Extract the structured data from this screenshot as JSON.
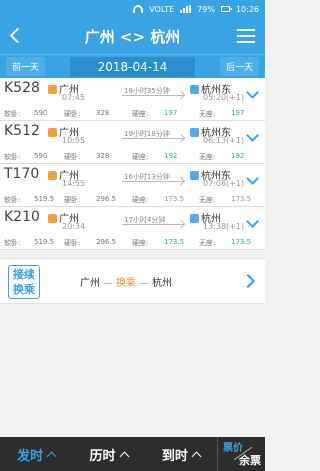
{
  "status_bar": {
    "volte": "VOLTE",
    "battery": "79%",
    "time": "10:26"
  },
  "header": {
    "title": "广州 <> 杭州"
  },
  "date_bar": {
    "prev_label": "前一天",
    "date": "2018-04-14",
    "next_label": "后一天"
  },
  "trains": [
    {
      "code": "K528",
      "from": "广州",
      "to": "杭州东",
      "dep": "07:45",
      "arr": "05:20(+1)",
      "duration": "18小时35分钟",
      "soft_sleeper_label": "软卧:",
      "soft_sleeper": "590",
      "hard_sleeper_label": "硬卧:",
      "hard_sleeper": "328",
      "hard_seat_label": "硬座:",
      "hard_seat": "197",
      "standing_label": "无座:",
      "standing": "197"
    },
    {
      "code": "K512",
      "from": "广州",
      "to": "杭州东",
      "dep": "10:55",
      "arr": "06:13(+1)",
      "duration": "19小时18分钟",
      "soft_sleeper_label": "软卧:",
      "soft_sleeper": "590",
      "hard_sleeper_label": "硬卧:",
      "hard_sleeper": "328",
      "hard_seat_label": "硬座:",
      "hard_seat": "192",
      "standing_label": "无座:",
      "standing": "192"
    },
    {
      "code": "T170",
      "from": "广州",
      "to": "杭州东",
      "dep": "14:55",
      "arr": "07:08(+1)",
      "duration": "16小时13分钟",
      "soft_sleeper_label": "软卧:",
      "soft_sleeper": "519.5",
      "hard_sleeper_label": "硬卧:",
      "hard_sleeper": "296.5",
      "hard_seat_label": "硬座:",
      "hard_seat": "173.5",
      "standing_label": "无座:",
      "standing": "173.5"
    },
    {
      "code": "K210",
      "from": "广州",
      "to": "杭州",
      "dep": "20:34",
      "arr": "13:38(+1)",
      "duration": "17小时4分钟",
      "soft_sleeper_label": "软卧:",
      "soft_sleeper": "519.5",
      "hard_sleeper_label": "硬卧:",
      "hard_sleeper": "296.5",
      "hard_seat_label": "硬座:",
      "hard_seat": "173.5",
      "standing_label": "无座:",
      "standing": "173.5"
    }
  ],
  "transfer": {
    "button_line1": "接续",
    "button_line2": "换乘",
    "from": "广州",
    "via": "换乘",
    "to": "杭州",
    "dash": "—"
  },
  "bottom_bar": {
    "dep_sort": "发时",
    "duration_sort": "历时",
    "arr_sort": "到时",
    "price_label": "票价",
    "remaining_label": "余票"
  },
  "colors": {
    "primary": "#3aa3e3",
    "available": "#33aa99",
    "sold_out": "#999999",
    "orange": "#f08c2c"
  }
}
